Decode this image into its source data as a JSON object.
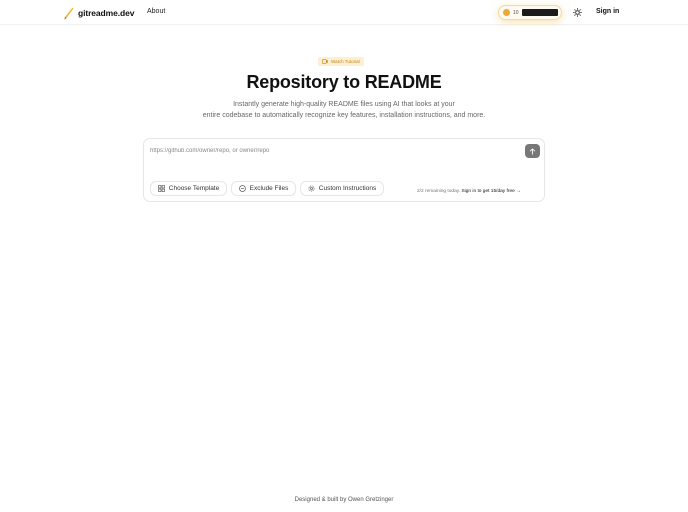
{
  "header": {
    "logo_text": "gitreadme.dev",
    "nav": {
      "about": "About"
    },
    "github_star_count": "10",
    "sign_in": "Sign in"
  },
  "hero": {
    "badge": "Watch Tutorial",
    "title": "Repository to README",
    "subtitle_line1": "Instantly generate high-quality README files using AI that looks at your",
    "subtitle_line2": "entire codebase to automatically recognize key features, installation instructions, and more."
  },
  "input_card": {
    "placeholder": "https://github.com/owner/repo, or owner/repo",
    "value": "",
    "buttons": {
      "template": "Choose Template",
      "exclude": "Exclude Files",
      "custom": "Custom Instructions"
    },
    "remaining": "2/2 remaining today.",
    "signin_cta": "Sign in to get 15/day free",
    "cta_arrow": "→"
  },
  "footer": {
    "text": "Designed & built by Owen Gretzinger"
  },
  "colors": {
    "accent": "#f5c86e",
    "badge_bg": "#fdf0d2",
    "badge_text": "#c48215",
    "submit_bg": "#777777"
  }
}
